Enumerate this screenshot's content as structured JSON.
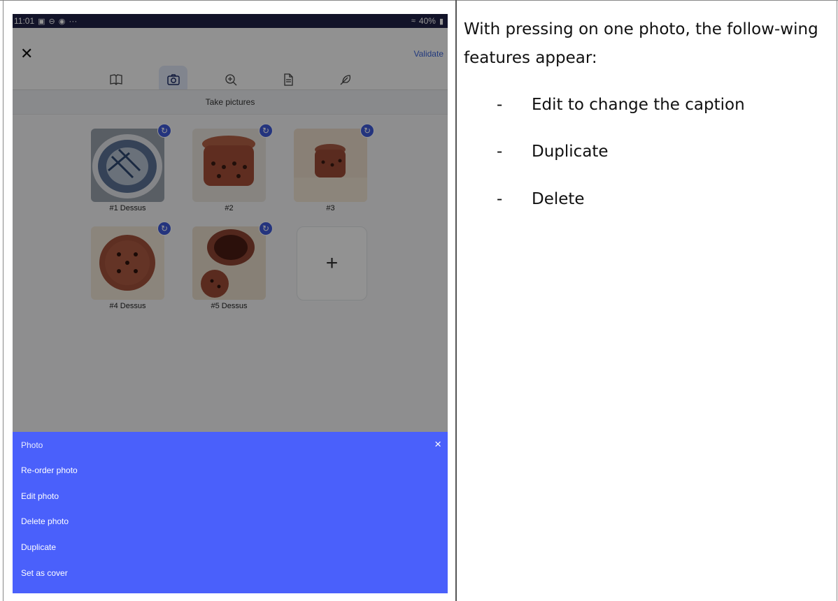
{
  "phone": {
    "status_bar": {
      "time": "11:01",
      "more": "···",
      "battery": "40%"
    },
    "app_bar": {
      "close_icon": "close-icon",
      "validate_label": "Validate",
      "steps": [
        "book-icon",
        "camera-icon",
        "zoom-in-icon",
        "document-icon",
        "feather-icon"
      ],
      "active_step": 1
    },
    "section_title": "Take pictures",
    "photos": [
      {
        "caption": "#1 Dessus"
      },
      {
        "caption": "#2"
      },
      {
        "caption": "#3"
      },
      {
        "caption": "#4 Dessus"
      },
      {
        "caption": "#5 Dessus"
      }
    ],
    "add_button_label": "+",
    "sheet": {
      "title": "Photo",
      "close_label": "×",
      "items": [
        "Re-order photo",
        "Edit photo",
        "Delete photo",
        "Duplicate",
        "Set as cover"
      ]
    },
    "colors": {
      "sheet_background": "#4a60fb",
      "accent": "#3f5ad9",
      "status_bar": "#1f2147"
    }
  },
  "document": {
    "paragraph": "With pressing on one photo, the follow-wing features appear:",
    "bullets": [
      {
        "dash": "-",
        "text": "Edit to change the caption"
      },
      {
        "dash": "-",
        "text": "Duplicate"
      },
      {
        "dash": "-",
        "text": "Delete"
      }
    ]
  }
}
